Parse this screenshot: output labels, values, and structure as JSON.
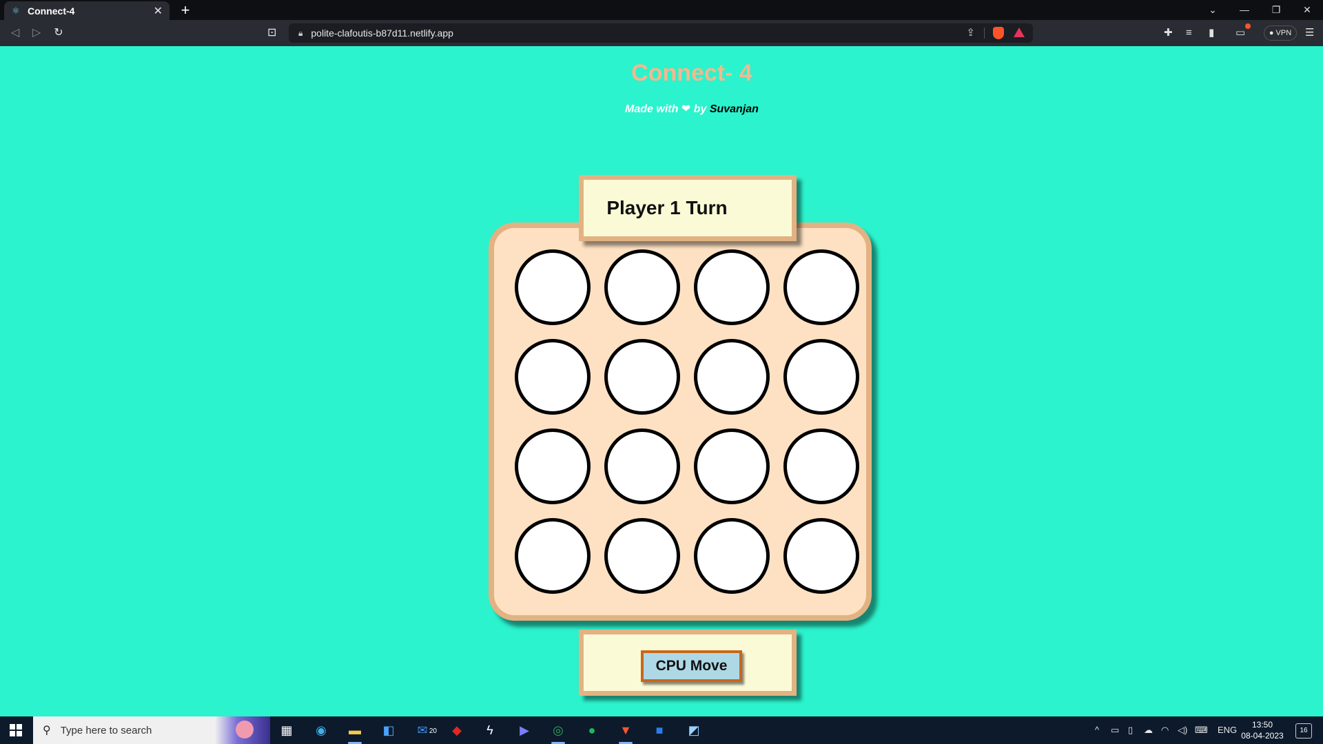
{
  "browser": {
    "tab_title": "Connect-4",
    "url": "polite-clafoutis-b87d11.netlify.app",
    "vpn_label": "VPN"
  },
  "page": {
    "title": "Connect- 4",
    "credit_prefix": "Made with",
    "credit_heart": "❤",
    "credit_by": "by",
    "credit_author": "Suvanjan",
    "turn_text": "Player 1 Turn",
    "cpu_button_label": "CPU Move",
    "board": {
      "rows": 4,
      "cols": 4,
      "cells": [
        [
          "empty",
          "empty",
          "empty",
          "empty"
        ],
        [
          "empty",
          "empty",
          "empty",
          "empty"
        ],
        [
          "empty",
          "empty",
          "empty",
          "empty"
        ],
        [
          "empty",
          "empty",
          "empty",
          "empty"
        ]
      ]
    }
  },
  "colors": {
    "background": "#2af3cd",
    "title": "#f4b88e",
    "board_fill": "#fde1c2",
    "board_border": "#e3b283",
    "panel_fill": "#fbfad6",
    "cpu_button_fill": "#aed8e6",
    "cpu_button_border": "#c8661c"
  },
  "taskbar": {
    "search_placeholder": "Type here to search",
    "mail_badge": "20",
    "language": "ENG",
    "time": "13:50",
    "date": "08-04-2023",
    "notification_count": "16"
  }
}
